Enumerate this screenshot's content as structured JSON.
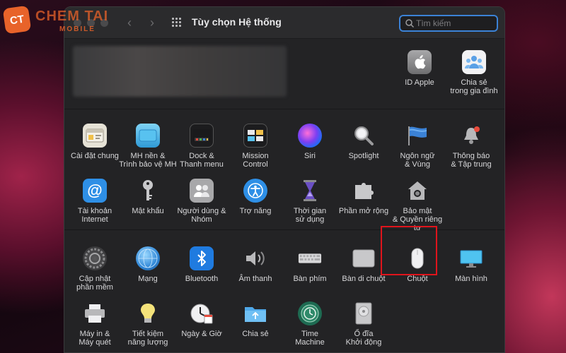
{
  "watermark": {
    "badge": "CT",
    "name": "CHEM TAI",
    "sub": "MOBILE"
  },
  "window": {
    "title": "Tùy chọn Hệ thống"
  },
  "search": {
    "placeholder": "Tìm kiếm",
    "value": ""
  },
  "account": {
    "items": [
      {
        "label": "ID Apple",
        "icon": "apple-icon"
      },
      {
        "label": "Chia sẻ\ntrong gia đình",
        "icon": "family-sharing-icon"
      }
    ]
  },
  "row1": [
    {
      "label": "Cài đặt chung",
      "icon": "general-icon"
    },
    {
      "label": "MH nền &\nTrình bảo vệ MH",
      "icon": "desktop-screensaver-icon"
    },
    {
      "label": "Dock &\nThanh menu",
      "icon": "dock-icon"
    },
    {
      "label": "Mission\nControl",
      "icon": "mission-control-icon"
    },
    {
      "label": "Siri",
      "icon": "siri-icon"
    },
    {
      "label": "Spotlight",
      "icon": "spotlight-icon"
    },
    {
      "label": "Ngôn ngữ\n& Vùng",
      "icon": "language-region-icon"
    },
    {
      "label": "Thông báo\n& Tập trung",
      "icon": "notifications-icon"
    }
  ],
  "row2": [
    {
      "label": "Tài khoản\nInternet",
      "icon": "internet-accounts-icon"
    },
    {
      "label": "Mật khẩu",
      "icon": "passwords-icon"
    },
    {
      "label": "Người dùng &\nNhóm",
      "icon": "users-groups-icon"
    },
    {
      "label": "Trợ năng",
      "icon": "accessibility-icon"
    },
    {
      "label": "Thời gian\nsử dụng",
      "icon": "screen-time-icon"
    },
    {
      "label": "Phần mở rộng",
      "icon": "extensions-icon"
    },
    {
      "label": "Bảo mật\n& Quyền riêng tư",
      "icon": "security-privacy-icon"
    }
  ],
  "row3": [
    {
      "label": "Cập nhật\nphần mềm",
      "icon": "software-update-icon"
    },
    {
      "label": "Mạng",
      "icon": "network-icon"
    },
    {
      "label": "Bluetooth",
      "icon": "bluetooth-icon"
    },
    {
      "label": "Âm thanh",
      "icon": "sound-icon"
    },
    {
      "label": "Bàn phím",
      "icon": "keyboard-icon"
    },
    {
      "label": "Bàn di chuột",
      "icon": "trackpad-icon"
    },
    {
      "label": "Chuột",
      "icon": "mouse-icon"
    },
    {
      "label": "Màn hình",
      "icon": "displays-icon"
    }
  ],
  "row4": [
    {
      "label": "Máy in &\nMáy quét",
      "icon": "printers-scanners-icon"
    },
    {
      "label": "Tiết kiệm\nnăng lượng",
      "icon": "energy-saver-icon"
    },
    {
      "label": "Ngày & Giờ",
      "icon": "date-time-icon"
    },
    {
      "label": "Chia sẻ",
      "icon": "sharing-icon"
    },
    {
      "label": "Time\nMachine",
      "icon": "time-machine-icon"
    },
    {
      "label": "Ổ đĩa\nKhởi động",
      "icon": "startup-disk-icon"
    }
  ],
  "colors": {
    "selection_outline": "#e0141c",
    "search_focus": "#3b82d6"
  }
}
